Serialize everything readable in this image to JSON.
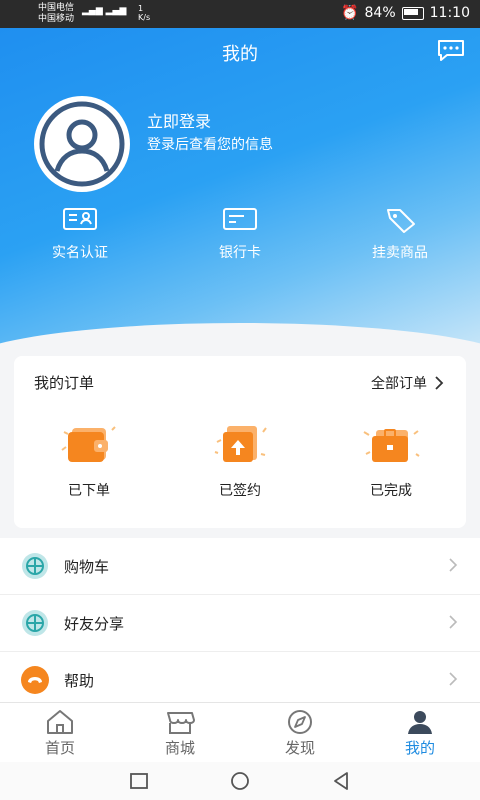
{
  "status_bar": {
    "carrier1": "中国电信",
    "carrier2": "中国移动",
    "speed_value": "1",
    "speed_unit": "K/s",
    "battery": "84%",
    "time": "11:10"
  },
  "header": {
    "title": "我的",
    "login_title": "立即登录",
    "login_subtitle": "登录后查看您的信息"
  },
  "quick_actions": [
    {
      "label": "实名认证",
      "icon": "id-card-icon"
    },
    {
      "label": "银行卡",
      "icon": "bank-card-icon"
    },
    {
      "label": "挂卖商品",
      "icon": "tag-icon"
    }
  ],
  "orders": {
    "title": "我的订单",
    "all_label": "全部订单",
    "items": [
      {
        "label": "已下单",
        "icon": "wallet-icon"
      },
      {
        "label": "已签约",
        "icon": "upload-box-icon"
      },
      {
        "label": "已完成",
        "icon": "briefcase-icon"
      }
    ]
  },
  "menu": [
    {
      "label": "购物车",
      "icon": "globe-icon"
    },
    {
      "label": "好友分享",
      "icon": "globe-icon"
    },
    {
      "label": "帮助",
      "icon": "phone-icon"
    }
  ],
  "tabs": [
    {
      "label": "首页",
      "icon": "home-icon"
    },
    {
      "label": "商城",
      "icon": "shop-icon"
    },
    {
      "label": "发现",
      "icon": "compass-icon"
    },
    {
      "label": "我的",
      "icon": "user-icon",
      "active": true
    }
  ],
  "colors": {
    "accent": "#1e8be0",
    "orange": "#f5861f"
  }
}
